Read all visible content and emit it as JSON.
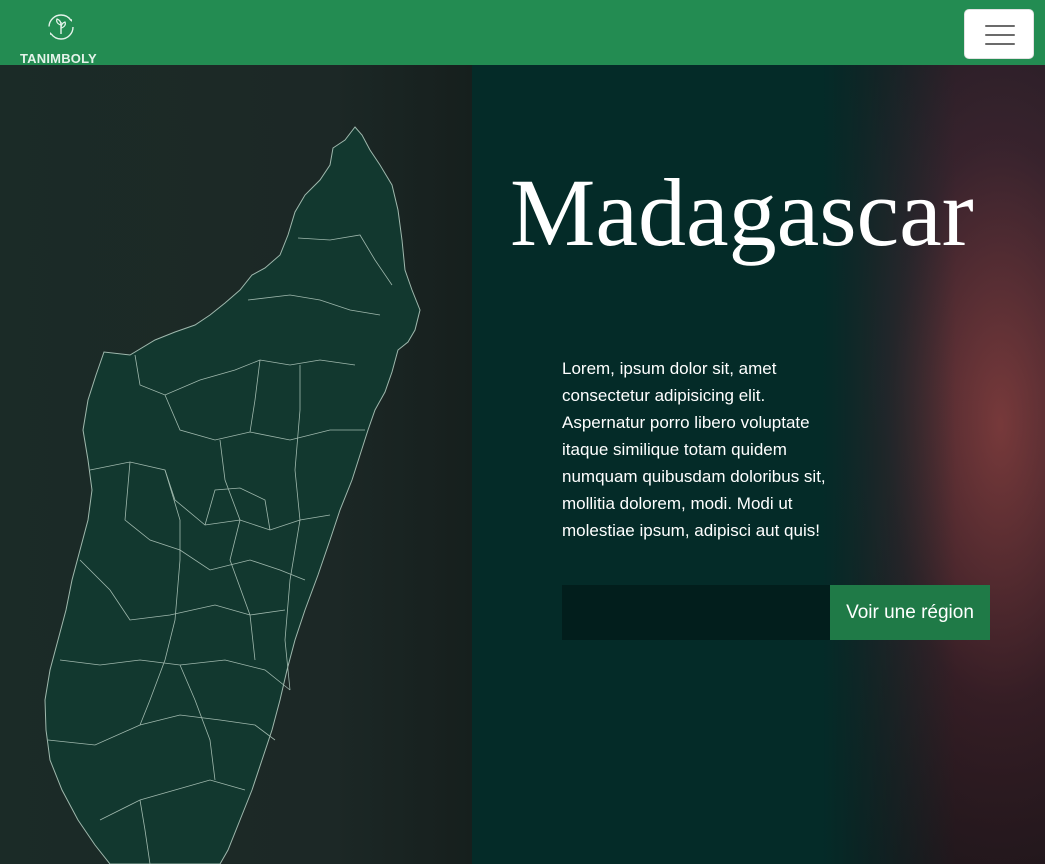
{
  "navbar": {
    "brand_name": "TANIMBOLY",
    "logo_icon": "sprout-cycle-icon",
    "menu_icon": "hamburger-menu-icon",
    "background_color": "#238c52"
  },
  "hero": {
    "title": "Madagascar",
    "description": "Lorem, ipsum dolor sit, amet consectetur adipisicing elit. Aspernatur porro libero voluptate itaque similique totam quidem numquam quibusdam doloribus sit, mollitia dolorem, modi. Modi ut molestiae ipsum, adipisci aut quis!",
    "region_input": {
      "value": "",
      "placeholder": ""
    },
    "region_button_label": "Voir une région",
    "accent_color": "#1f7a47"
  },
  "map": {
    "icon": "madagascar-regions-map",
    "fill_color": "#12382f",
    "border_color": "#9fb8ad"
  }
}
